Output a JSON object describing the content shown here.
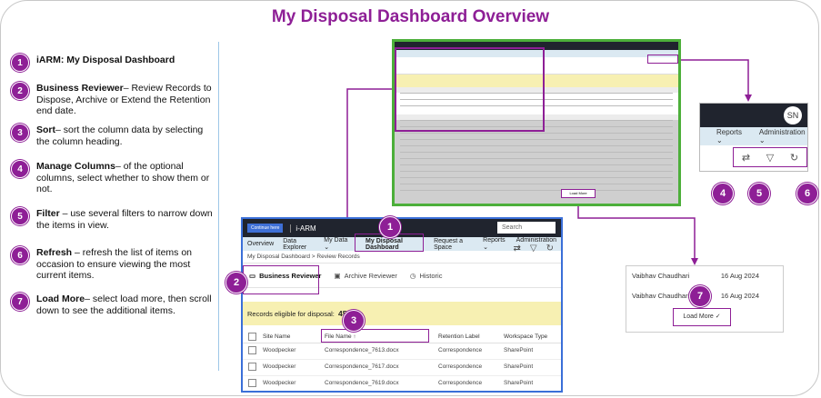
{
  "title": "My Disposal Dashboard Overview",
  "legend": [
    {
      "num": "1",
      "term": "iARM: My Disposal Dashboard",
      "desc": ""
    },
    {
      "num": "2",
      "term": "Business Reviewer",
      "desc": "– Review Records to Dispose, Archive or Extend the Retention end date."
    },
    {
      "num": "3",
      "term": "Sort",
      "desc": "– sort the column data by selecting the column heading."
    },
    {
      "num": "4",
      "term": "Manage Columns",
      "desc": "– of the optional columns, select whether to show them or not."
    },
    {
      "num": "5",
      "term": "Filter",
      "desc": " – use several filters to narrow down the items in view."
    },
    {
      "num": "6",
      "term": "Refresh",
      "desc": " – refresh the list of items on occasion to ensure viewing the most current items."
    },
    {
      "num": "7",
      "term": "Load More",
      "desc": "– select load more, then scroll down to see the additional items."
    }
  ],
  "app": {
    "continue_btn": "Continue here",
    "name": "i-ARM",
    "search_placeholder": "Search",
    "nav": [
      "Overview",
      "Data Explorer",
      "My Data ⌄",
      "My Disposal Dashboard",
      "Request a Space",
      "Reports ⌄",
      "Administration ⌄"
    ],
    "breadcrumb": "My Disposal Dashboard  >  Review Records",
    "tabs": [
      "Business Reviewer",
      "Archive Reviewer",
      "Historic"
    ],
    "records_label": "Records eligible for disposal:",
    "records_count": "4521",
    "columns": [
      "Site Name",
      "File Name ↑",
      "Retention Label",
      "Workspace Type"
    ],
    "rows": [
      [
        "Woodpecker",
        "Correspondence_7613.docx",
        "Correspondence",
        "SharePoint"
      ],
      [
        "Woodpecker",
        "Correspondence_7617.docx",
        "Correspondence",
        "SharePoint"
      ],
      [
        "Woodpecker",
        "Correspondence_7619.docx",
        "Correspondence",
        "SharePoint"
      ]
    ]
  },
  "zoom_top": {
    "initials": "SN",
    "nav": [
      "Reports ⌄",
      "Administration ⌄"
    ]
  },
  "zoom_bottom": {
    "rows": [
      {
        "name": "Vaibhav Chaudhari",
        "date": "16 Aug 2024"
      },
      {
        "name": "Vaibhav Chaudhari",
        "date": "16 Aug 2024"
      }
    ],
    "load_more": "Load More ✓"
  },
  "callouts": {
    "n1": "1",
    "n2": "2",
    "n3": "3",
    "n4": "4",
    "n5": "5",
    "n6": "6",
    "n7": "7"
  },
  "colors": {
    "accent": "#8e1f96",
    "green": "#4caf3a",
    "blue": "#3a6fd8"
  }
}
